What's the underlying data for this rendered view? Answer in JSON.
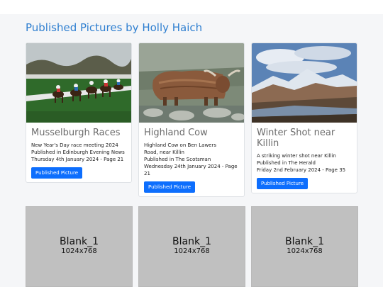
{
  "page": {
    "title": "Published Pictures by Holly Haich"
  },
  "cards": [
    {
      "title": "Musselburgh Races",
      "lines": [
        "New Year's Day race meeting 2024",
        "Published in Edinburgh Evening News",
        "Thursday 4th January 2024 - Page 21"
      ],
      "button": "Published Picture"
    },
    {
      "title": "Highland Cow",
      "lines": [
        "Highland Cow on Ben Lawers Road, near Killin",
        "Published in The Scotsman",
        "Wednesday 24th January 2024 - Page 21"
      ],
      "button": "Published Picture"
    },
    {
      "title": "Winter Shot near Killin",
      "lines": [
        "A striking winter shot near Killin",
        "Published in The Herald",
        "Friday 2nd February 2024 - Page 35"
      ],
      "button": "Published Picture"
    }
  ],
  "placeholders": [
    {
      "label": "Blank_1",
      "size": "1024x768"
    },
    {
      "label": "Blank_1",
      "size": "1024x768"
    },
    {
      "label": "Blank_1",
      "size": "1024x768"
    }
  ]
}
